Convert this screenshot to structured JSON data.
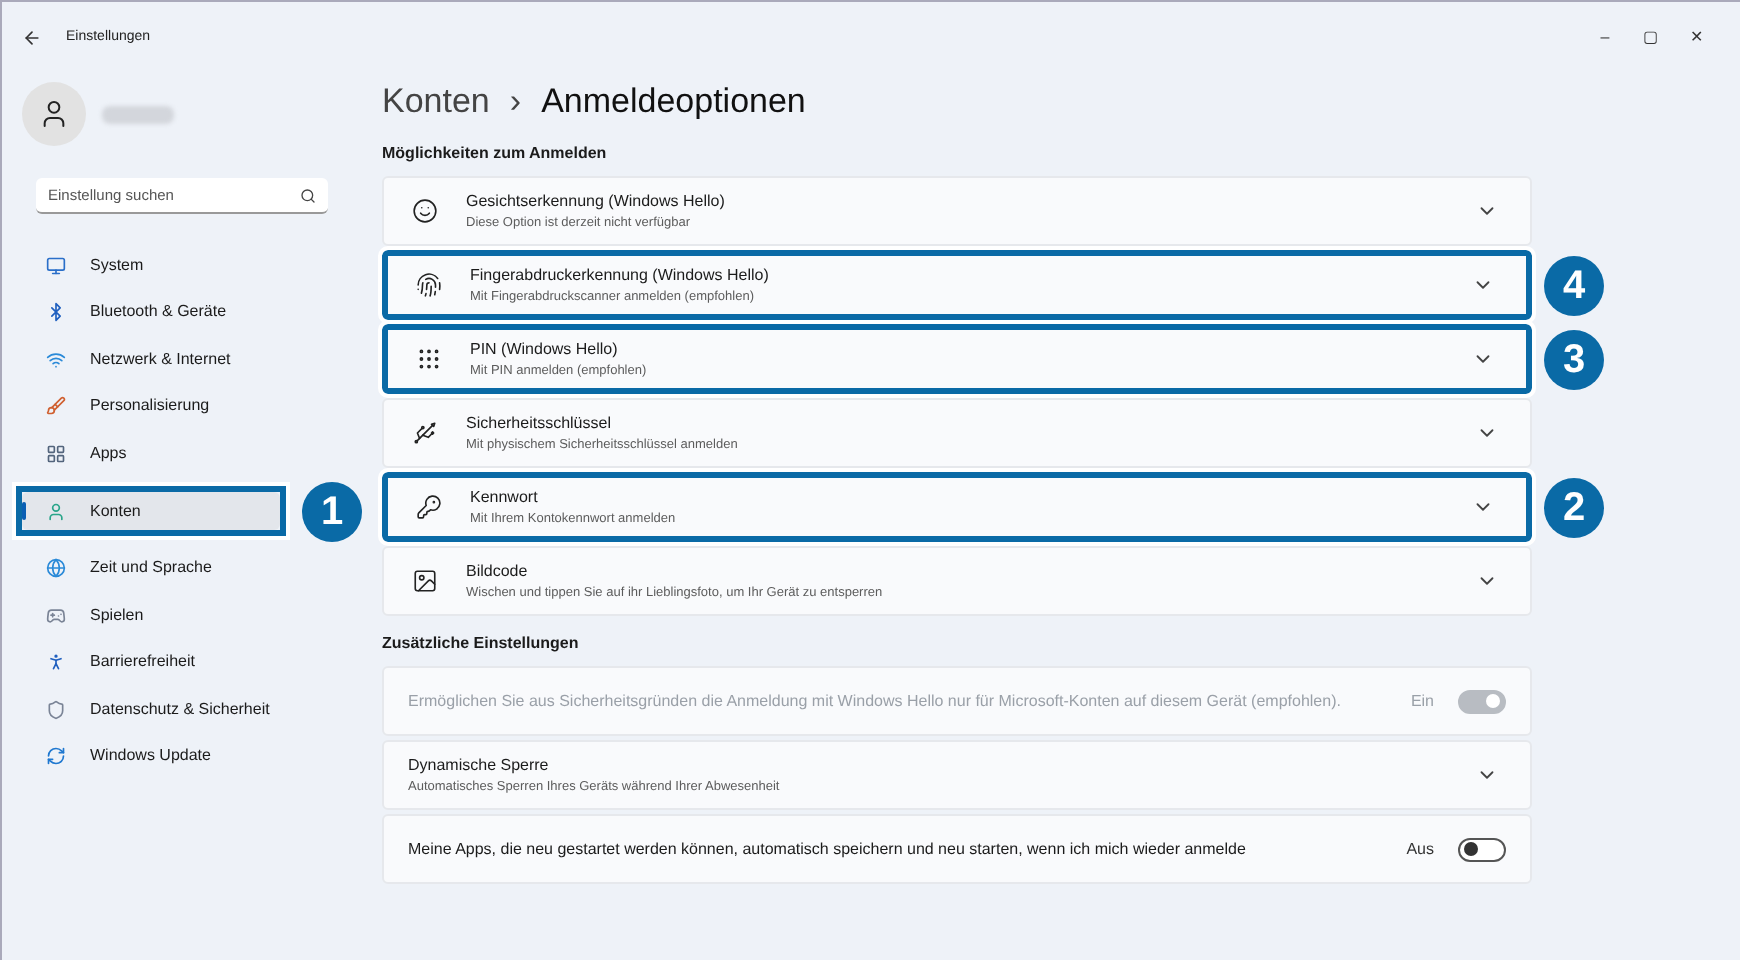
{
  "window": {
    "title": "Einstellungen",
    "controls": [
      "–",
      "▢",
      "✕"
    ]
  },
  "search": {
    "placeholder": "Einstellung suchen"
  },
  "nav": [
    {
      "label": "System",
      "selected": false
    },
    {
      "label": "Bluetooth & Geräte",
      "selected": false
    },
    {
      "label": "Netzwerk & Internet",
      "selected": false
    },
    {
      "label": "Personalisierung",
      "selected": false
    },
    {
      "label": "Apps",
      "selected": false
    },
    {
      "label": "Konten",
      "selected": true,
      "callout": "1"
    },
    {
      "label": "Zeit und Sprache",
      "selected": false
    },
    {
      "label": "Spielen",
      "selected": false
    },
    {
      "label": "Barrierefreiheit",
      "selected": false
    },
    {
      "label": "Datenschutz & Sicherheit",
      "selected": false
    },
    {
      "label": "Windows Update",
      "selected": false
    }
  ],
  "breadcrumb": {
    "parent": "Konten",
    "separator": "›",
    "current": "Anmeldeoptionen"
  },
  "sections": [
    {
      "heading": "Möglichkeiten zum Anmelden",
      "items": [
        {
          "kind": "expander",
          "title": "Gesichtserkennung (Windows Hello)",
          "subtitle": "Diese Option ist derzeit nicht verfügbar"
        },
        {
          "kind": "expander",
          "title": "Fingerabdruckerkennung (Windows Hello)",
          "subtitle": "Mit Fingerabdruckscanner anmelden (empfohlen)",
          "callout": "4"
        },
        {
          "kind": "expander",
          "title": "PIN (Windows Hello)",
          "subtitle": "Mit PIN anmelden (empfohlen)",
          "callout": "3"
        },
        {
          "kind": "expander",
          "title": "Sicherheitsschlüssel",
          "subtitle": "Mit physischem Sicherheitsschlüssel anmelden"
        },
        {
          "kind": "expander",
          "title": "Kennwort",
          "subtitle": "Mit Ihrem Kontokennwort anmelden",
          "callout": "2"
        },
        {
          "kind": "expander",
          "title": "Bildcode",
          "subtitle": "Wischen und tippen Sie auf ihr Lieblingsfoto, um Ihr Gerät zu entsperren"
        }
      ]
    },
    {
      "heading": "Zusätzliche Einstellungen",
      "items": [
        {
          "kind": "toggle",
          "title": "Ermöglichen Sie aus Sicherheitsgründen die Anmeldung mit Windows Hello nur für Microsoft-Konten auf diesem Gerät (empfohlen).",
          "state_text": "Ein",
          "on": true,
          "disabled": true
        },
        {
          "kind": "expander",
          "title": "Dynamische Sperre",
          "subtitle": "Automatisches Sperren Ihres Geräts während Ihrer Abwesenheit"
        },
        {
          "kind": "toggle",
          "title": "Meine Apps, die neu gestartet werden können, automatisch speichern und neu starten, wenn ich mich wieder anmelde",
          "state_text": "Aus",
          "on": false,
          "disabled": false
        }
      ]
    }
  ]
}
